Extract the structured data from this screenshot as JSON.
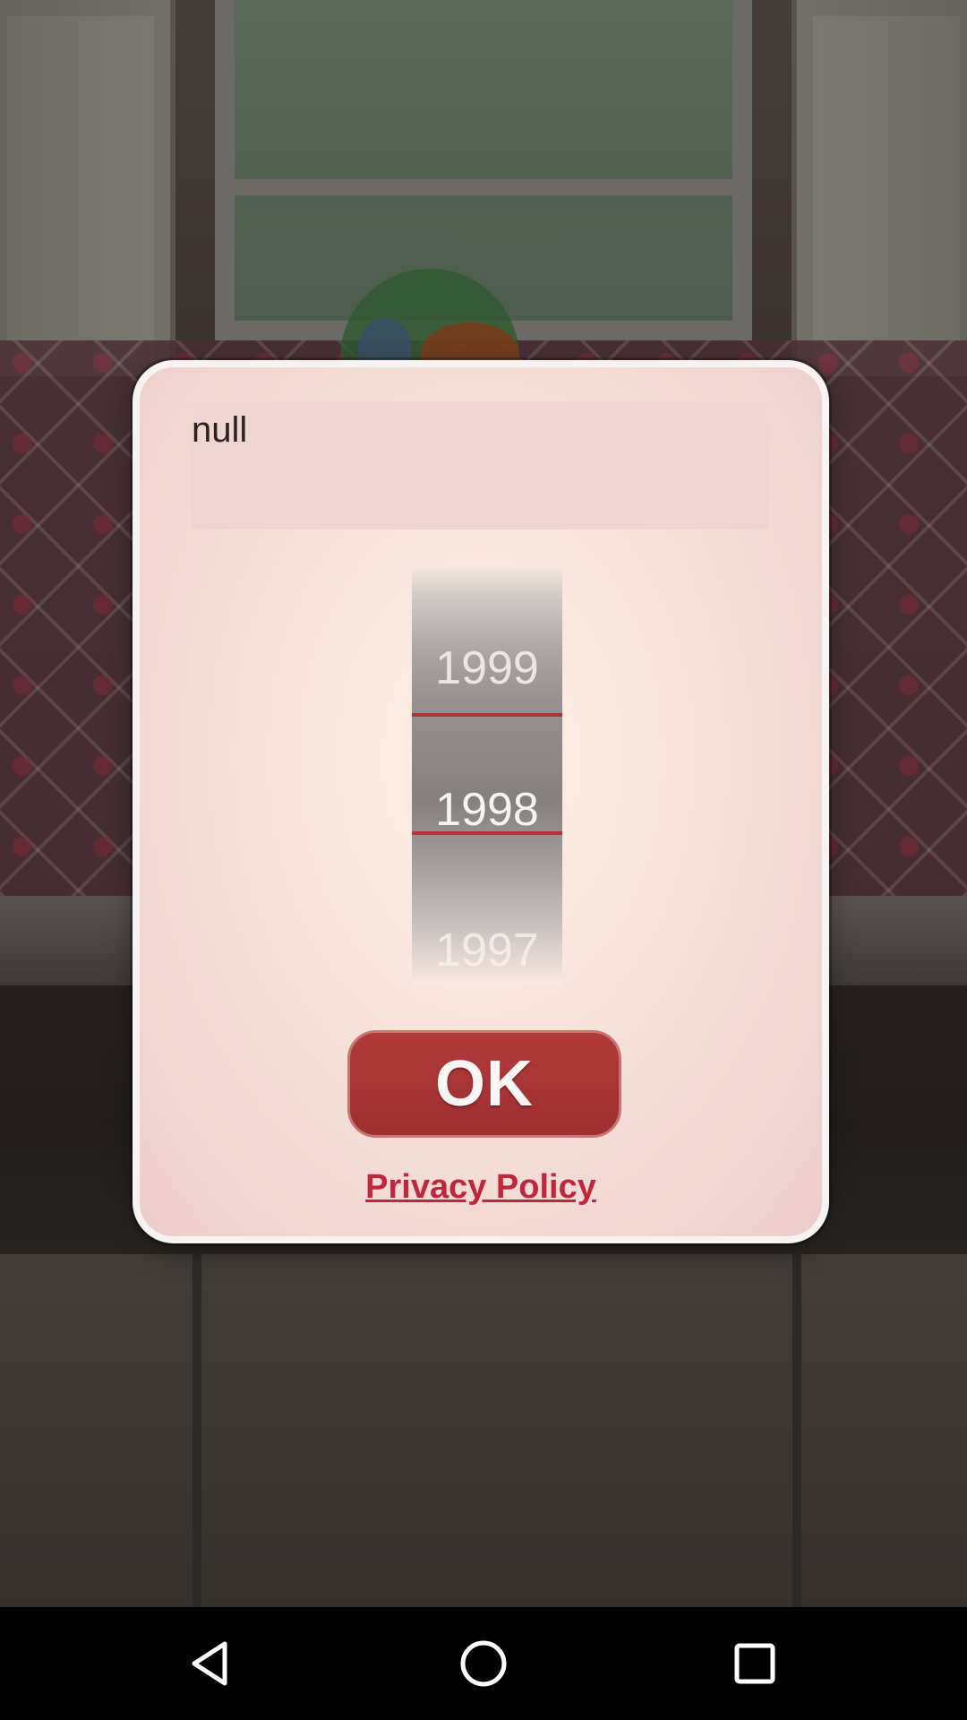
{
  "dialog": {
    "message": "null",
    "year_picker": {
      "previous": "1999",
      "selected": "1998",
      "next": "1997"
    },
    "ok_label": "OK",
    "privacy_label": "Privacy Policy"
  },
  "colors": {
    "accent": "#a8333a",
    "link": "#c1273a",
    "dialog_bg": "#f8e3dc"
  },
  "nav_bar": {
    "back_icon": "back-triangle-icon",
    "home_icon": "home-circle-icon",
    "recents_icon": "recents-square-icon"
  }
}
